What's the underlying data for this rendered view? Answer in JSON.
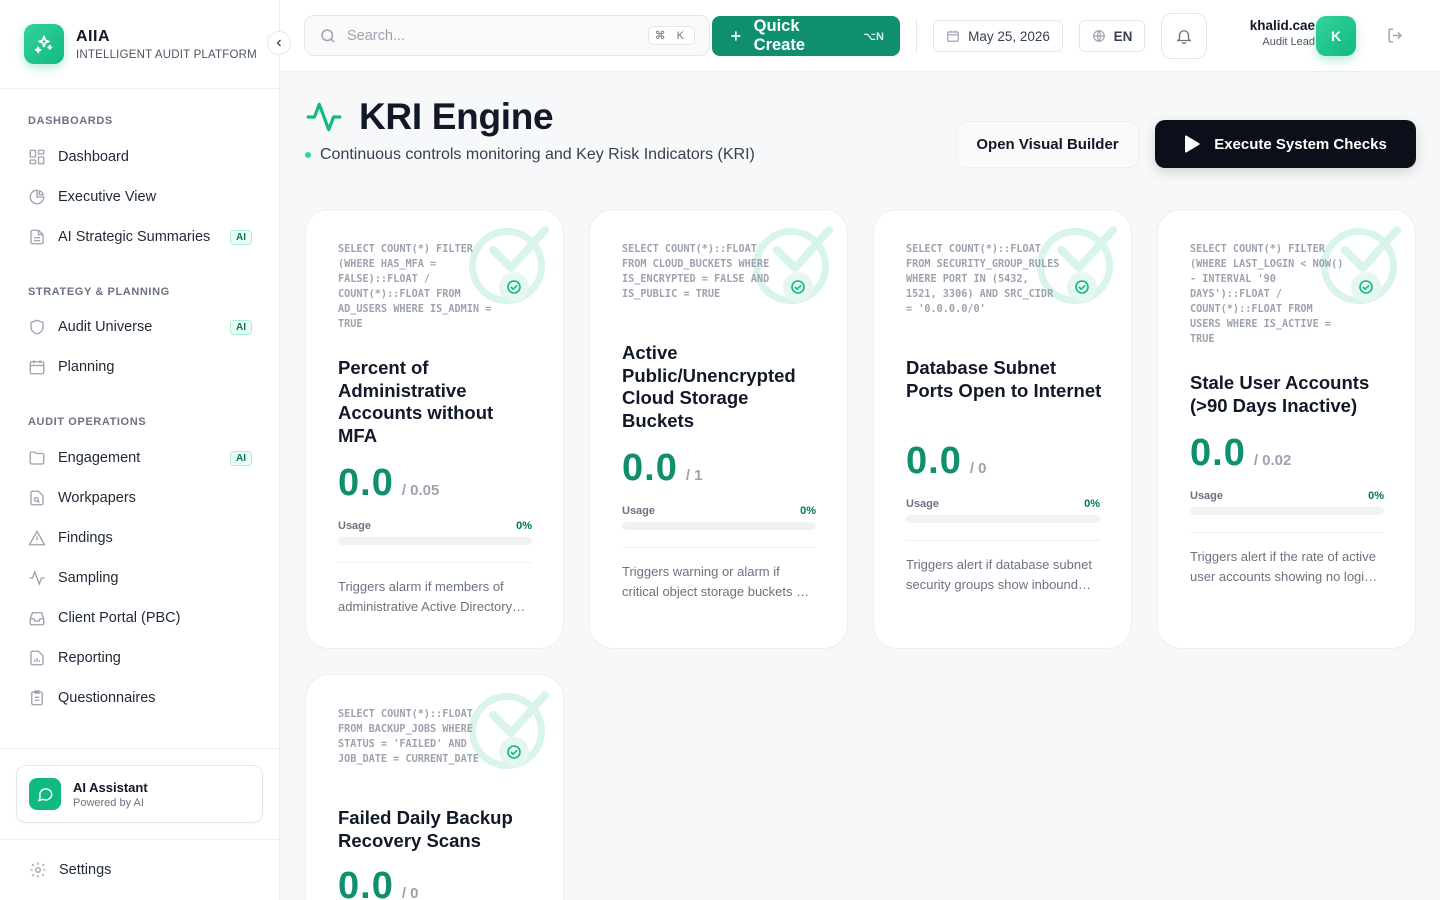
{
  "brand": {
    "title": "AIIA",
    "subtitle": "INTELLIGENT AUDIT PLATFORM"
  },
  "sidebar": {
    "sections": [
      {
        "title": "DASHBOARDS"
      },
      {
        "title": "STRATEGY & PLANNING"
      },
      {
        "title": "AUDIT OPERATIONS"
      }
    ],
    "items": [
      {
        "label": "Dashboard",
        "icon": "grid-icon"
      },
      {
        "label": "Executive View",
        "icon": "pie-chart-icon"
      },
      {
        "label": "AI Strategic Summaries",
        "icon": "document-icon",
        "badge": "AI"
      },
      {
        "label": "Audit Universe",
        "icon": "shield-icon",
        "badge": "AI"
      },
      {
        "label": "Planning",
        "icon": "calendar-icon"
      },
      {
        "label": "Engagement",
        "icon": "folder-icon",
        "badge": "AI"
      },
      {
        "label": "Workpapers",
        "icon": "file-search-icon"
      },
      {
        "label": "Findings",
        "icon": "warning-icon"
      },
      {
        "label": "Sampling",
        "icon": "activity-icon"
      },
      {
        "label": "Client Portal (PBC)",
        "icon": "inbox-icon"
      },
      {
        "label": "Reporting",
        "icon": "report-icon"
      },
      {
        "label": "Questionnaires",
        "icon": "clipboard-icon"
      }
    ],
    "assistant": {
      "title": "AI Assistant",
      "subtitle": "Powered by AI"
    },
    "settings": "Settings"
  },
  "header": {
    "search_placeholder": "Search...",
    "search_kbd": "⌘ K",
    "quick_create": "Quick Create",
    "quick_create_kbd": "⌥N",
    "date": "May 25, 2026",
    "language": "EN",
    "user": {
      "name": "khalid.cae",
      "role": "Audit Lead",
      "initial": "K"
    }
  },
  "page": {
    "title": "KRI Engine",
    "subtitle": "Continuous controls monitoring and Key Risk Indicators (KRI)",
    "visual_builder": "Open Visual Builder",
    "execute": "Execute System Checks"
  },
  "colors": {
    "accent": "#0f8f6e",
    "accent_light": "#10b981",
    "dark_button": "#0b0f1a"
  },
  "cards": [
    {
      "query": "SELECT COUNT(*) FILTER (WHERE HAS_MFA = FALSE)::FLOAT / COUNT(*)::FLOAT FROM AD_USERS WHERE IS_ADMIN = TRUE",
      "title": "Percent of Administrative Accounts without MFA",
      "value": "0.0",
      "threshold": "/ 0.05",
      "usage_label": "Usage",
      "usage_pct": "0%",
      "usage": 0,
      "description": "Triggers alarm if members of administrative Active Directory groups do not have MFA enabled."
    },
    {
      "query": "SELECT COUNT(*)::FLOAT FROM CLOUD_BUCKETS WHERE IS_ENCRYPTED = FALSE AND IS_PUBLIC = TRUE",
      "title": "Active Public/Unencrypted Cloud Storage Buckets",
      "value": "0.0",
      "threshold": "/ 1",
      "usage_label": "Usage",
      "usage_pct": "0%",
      "usage": 0,
      "description": "Triggers warning or alarm if critical object storage buckets are publicly accessible or unencrypted."
    },
    {
      "query": "SELECT COUNT(*)::FLOAT FROM SECURITY_GROUP_RULES WHERE PORT IN (5432, 1521, 3306) AND SRC_CIDR = '0.0.0.0/0'",
      "title": "Database Subnet Ports Open to Internet",
      "value": "0.0",
      "threshold": "/ 0",
      "usage_label": "Usage",
      "usage_pct": "0%",
      "usage": 0,
      "description": "Triggers alert if database subnet security groups show inbound access from the public internet."
    },
    {
      "query": "SELECT COUNT(*) FILTER (WHERE LAST_LOGIN < NOW() - INTERVAL '90 DAYS')::FLOAT / COUNT(*)::FLOAT FROM USERS WHERE IS_ACTIVE = TRUE",
      "title": "Stale User Accounts (>90 Days Inactive)",
      "value": "0.0",
      "threshold": "/ 0.02",
      "usage_label": "Usage",
      "usage_pct": "0%",
      "usage": 0,
      "description": "Triggers alert if the rate of active user accounts showing no login activity exceeds the threshold."
    },
    {
      "query": "SELECT COUNT(*)::FLOAT FROM BACKUP_JOBS WHERE STATUS = 'FAILED' AND JOB_DATE = CURRENT_DATE",
      "title": "Failed Daily Backup Recovery Scans",
      "value": "0.0",
      "threshold": "/ 0"
    }
  ]
}
